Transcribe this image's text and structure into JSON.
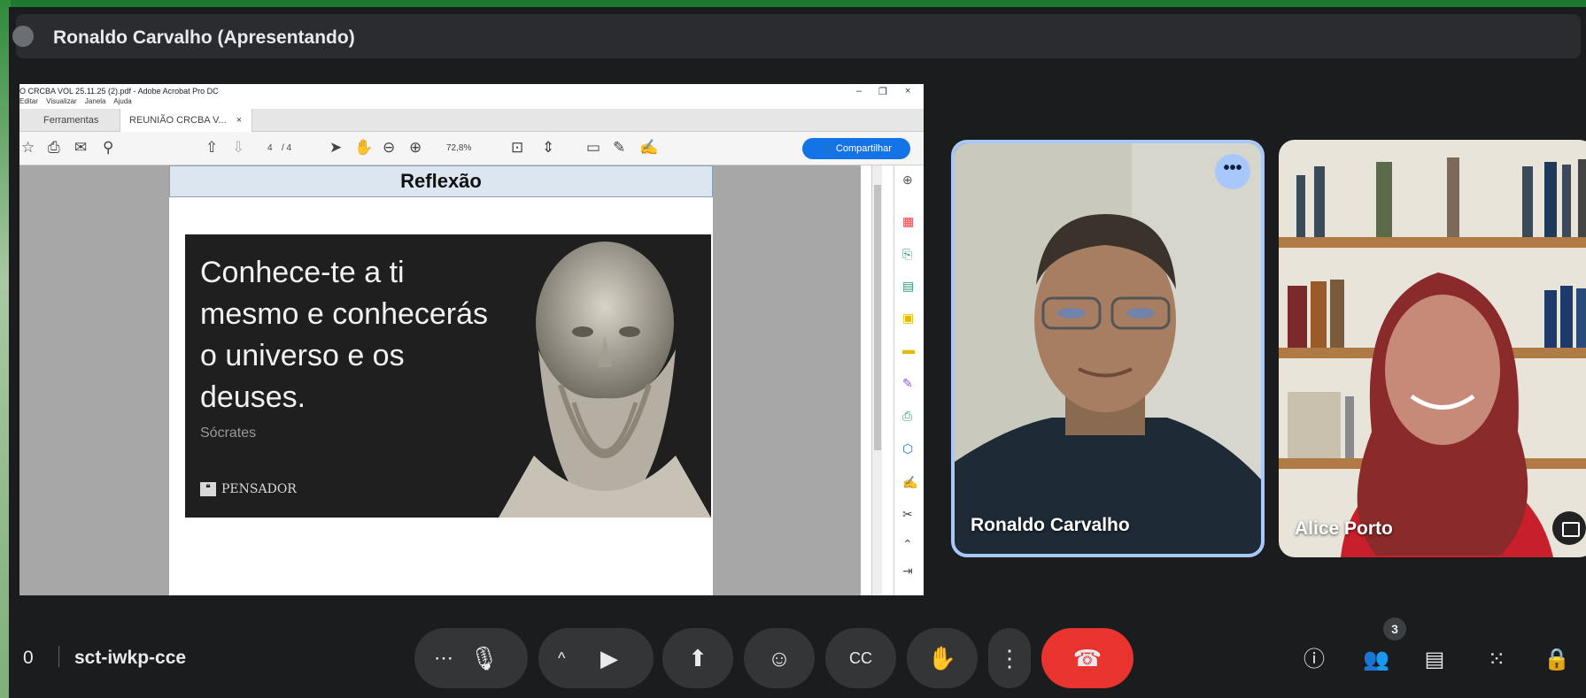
{
  "header": {
    "title": "Ronaldo Carvalho (Apresentando)"
  },
  "acrobat": {
    "window_title": "O CRCBA VOL 25.11.25 (2).pdf - Adobe Acrobat Pro DC",
    "menu": [
      "Editar",
      "Visualizar",
      "Janela",
      "Ajuda"
    ],
    "window_controls": [
      "–",
      "❐",
      "×"
    ],
    "tabs": [
      "Ferramentas",
      "REUNIÃO CRCBA V..."
    ],
    "tab_close": "×",
    "page_current": "4",
    "page_total": "/ 4",
    "zoom": "72,8%",
    "share_label": "Compartilhar",
    "slide_heading": "Reflexão",
    "quote": {
      "text": "Conhece-te a ti mesmo e conhecerás o universo e os deuses.",
      "author": "Sócrates",
      "source": "PENSADOR"
    }
  },
  "participants": [
    {
      "name": "Ronaldo Carvalho",
      "more_label": "•••"
    },
    {
      "name": "Alice Porto"
    }
  ],
  "meeting": {
    "time": "0",
    "code": "sct-iwkp-cce",
    "people_count": "3"
  },
  "controls": {
    "more_options": "⋯",
    "mic": "mic-icon",
    "camera": "videocam-icon",
    "present": "present-icon",
    "reactions": "emoji-icon",
    "captions": "cc-icon",
    "raise_hand": "hand-icon",
    "more_vert": "more-vert-icon",
    "end_call": "call-end-icon"
  },
  "colors": {
    "accent": "#a8c7fa",
    "end_call": "#e8332e",
    "border": "#1c7a2c",
    "acrobat_blue": "#1473e6"
  }
}
